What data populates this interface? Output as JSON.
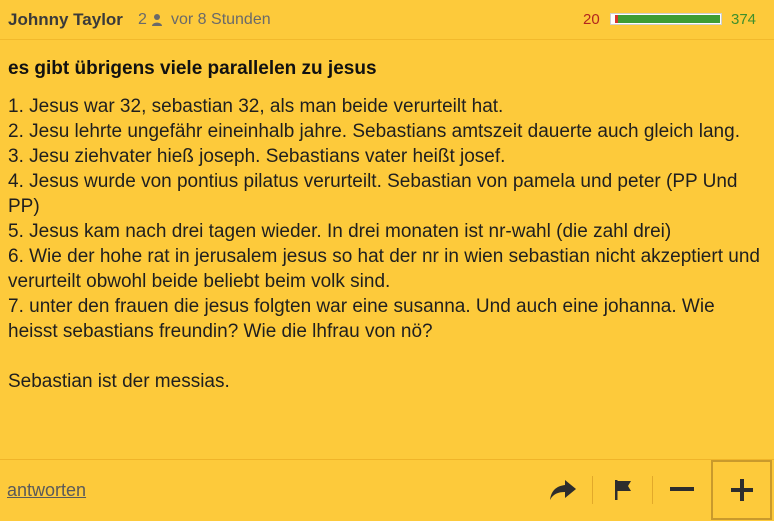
{
  "comment": {
    "author": "Johnny Taylor",
    "user_count": "2",
    "timestamp": "vor 8 Stunden",
    "rating": {
      "negative": "20",
      "positive": "374",
      "negative_fraction": 0.051,
      "positive_fraction": 0.949,
      "negative_color": "#d9352c",
      "positive_color": "#3e9d34"
    },
    "title": "es gibt übrigens viele parallelen zu jesus",
    "body_lines": [
      "1. Jesus war 32, sebastian 32, als man beide verurteilt hat.",
      "2. Jesu lehrte ungefähr eineinhalb jahre. Sebastians amtszeit dauerte auch gleich lang.",
      "3. Jesu ziehvater hieß joseph. Sebastians vater heißt josef.",
      "4. Jesus wurde von pontius pilatus verurteilt. Sebastian von pamela und peter (PP Und PP)",
      "5. Jesus kam nach drei tagen wieder. In drei monaten ist nr-wahl (die zahl drei)",
      "6. Wie der hohe rat in jerusalem jesus so hat der nr in wien sebastian nicht akzeptiert und verurteilt obwohl beide beliebt beim volk sind.",
      "7. unter den frauen die jesus folgten war eine susanna. Und auch eine johanna. Wie heisst sebastians freundin? Wie die lhfrau von nö?"
    ],
    "closing": "Sebastian ist der messias."
  },
  "actions": {
    "reply_label": "antworten",
    "share_icon": "share-arrow-icon",
    "report_icon": "flag-icon",
    "downvote_icon": "minus-icon",
    "upvote_icon": "plus-icon"
  },
  "colors": {
    "background": "#fdca3b",
    "text": "#1f1f1f",
    "meta_text": "#6a6a6a"
  }
}
